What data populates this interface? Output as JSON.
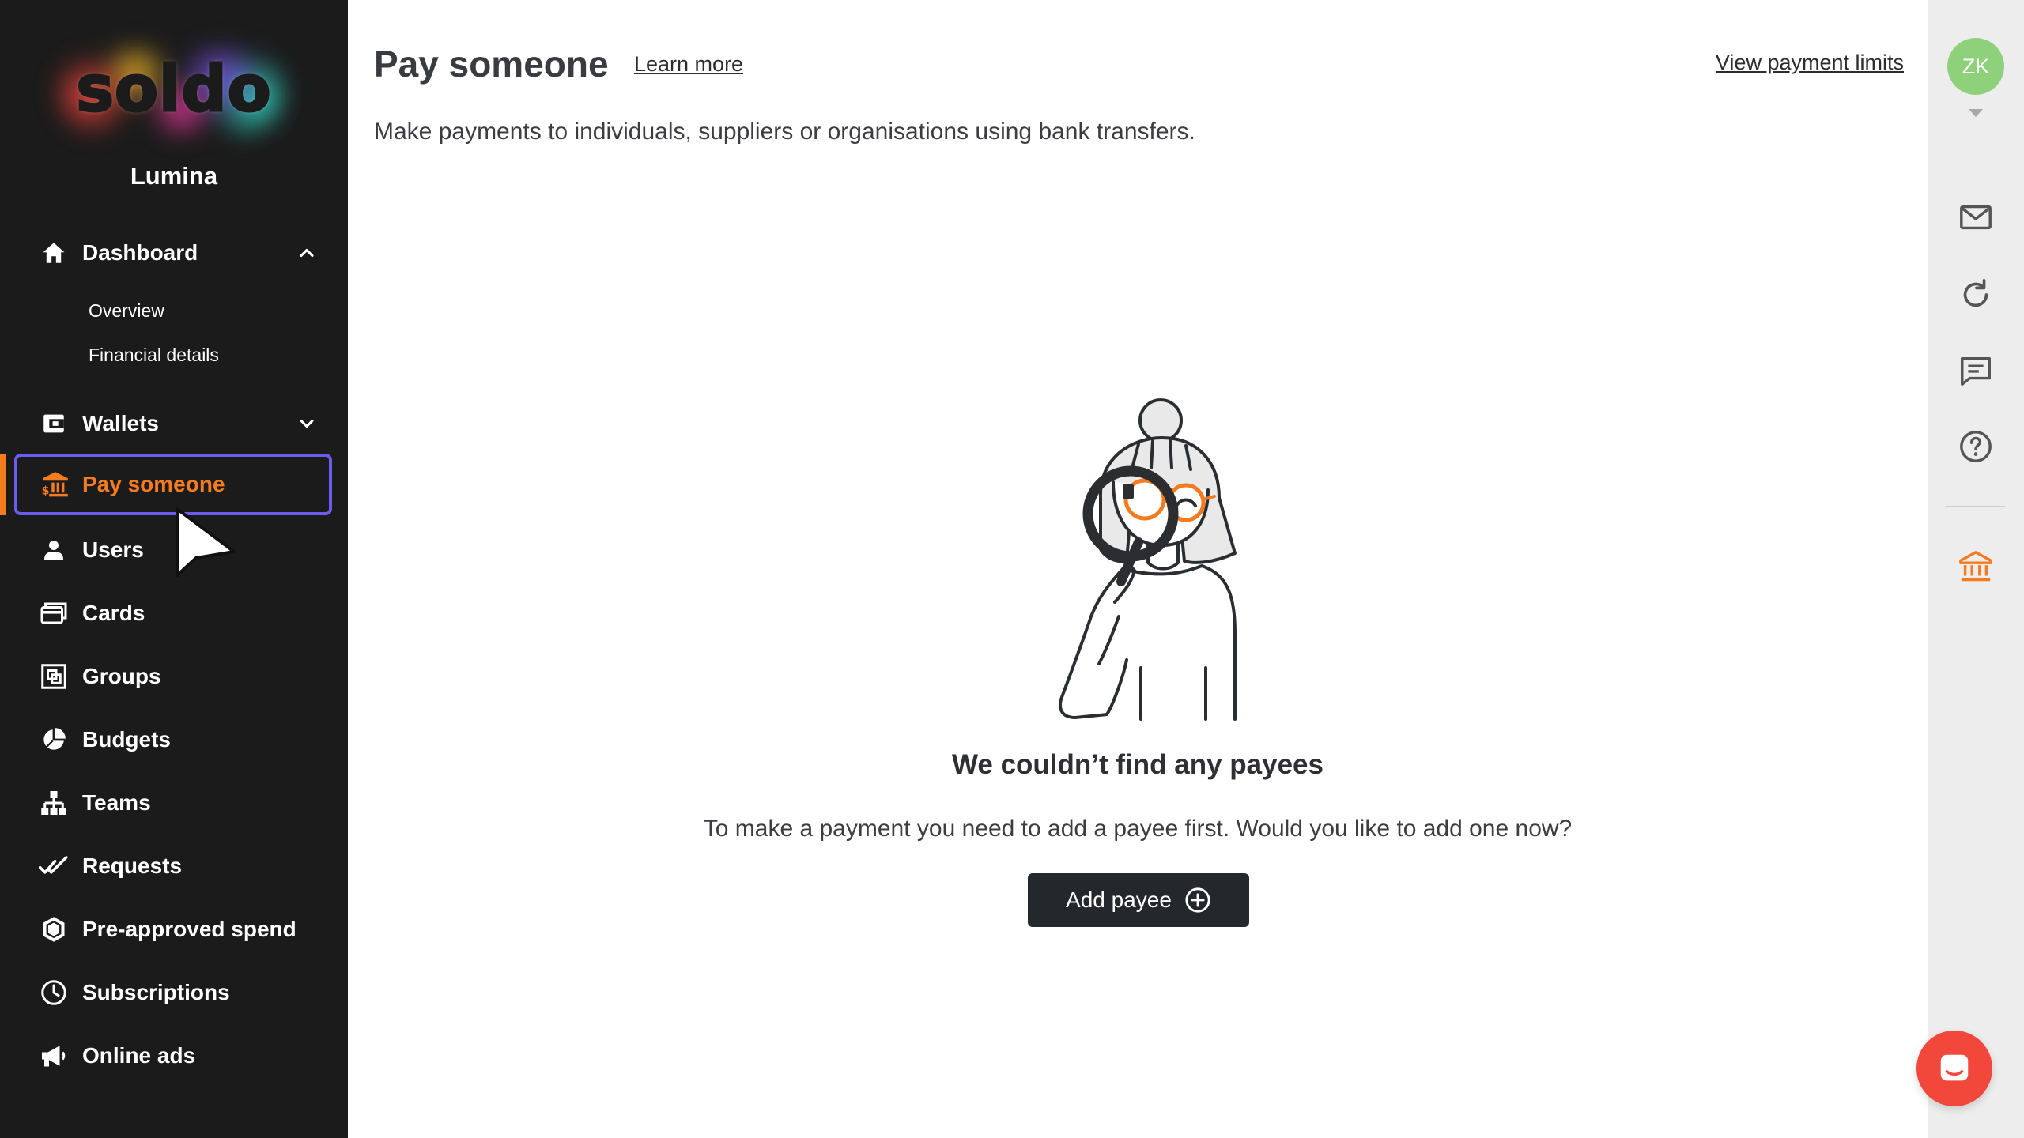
{
  "sidebar": {
    "logo": "soldo",
    "org_name": "Lumina",
    "dashboard": {
      "label": "Dashboard",
      "sub_items": [
        "Overview",
        "Financial details"
      ]
    },
    "wallets": {
      "label": "Wallets"
    },
    "pay_someone": {
      "label": "Pay someone"
    },
    "users": {
      "label": "Users"
    },
    "cards": {
      "label": "Cards"
    },
    "groups": {
      "label": "Groups"
    },
    "budgets": {
      "label": "Budgets"
    },
    "teams": {
      "label": "Teams"
    },
    "requests": {
      "label": "Requests"
    },
    "pre_approved": {
      "label": "Pre-approved spend"
    },
    "subscriptions": {
      "label": "Subscriptions"
    },
    "online_ads": {
      "label": "Online ads"
    }
  },
  "main": {
    "title": "Pay someone",
    "learn_more": "Learn more",
    "view_limits": "View payment limits",
    "description": "Make payments to individuals, suppliers or organisations using bank transfers.",
    "empty_title": "We couldn’t find any payees",
    "empty_desc": "To make a payment you need to add a payee first. Would you like to add one now?",
    "add_payee": "Add payee"
  },
  "right_rail": {
    "avatar_initials": "ZK",
    "icons": [
      "mail-icon",
      "refresh-icon",
      "message-icon",
      "help-icon",
      "bank-icon"
    ]
  },
  "colors": {
    "sidebar_bg": "#1b1b1b",
    "accent_orange": "#f47b20",
    "active_outline": "#6b5cf0",
    "avatar_bg": "#8fd17a",
    "button_bg": "#24272b",
    "chat_launcher": "#f2473b"
  }
}
